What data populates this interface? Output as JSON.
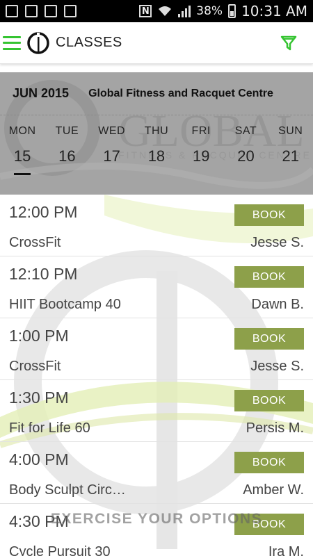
{
  "status_bar": {
    "battery": "38%",
    "time": "10:31 AM"
  },
  "header": {
    "title": "CLASSES"
  },
  "calendar": {
    "month": "JUN 2015",
    "gym_name": "Global Fitness and Racquet Centre",
    "watermark": {
      "brand": "GLOBAL",
      "sub": "FITNESS & RACQUET CENTRE"
    },
    "days": [
      {
        "name": "MON",
        "num": "15"
      },
      {
        "name": "TUE",
        "num": "16"
      },
      {
        "name": "WED",
        "num": "17"
      },
      {
        "name": "THU",
        "num": "18"
      },
      {
        "name": "FRI",
        "num": "19"
      },
      {
        "name": "SAT",
        "num": "20"
      },
      {
        "name": "SUN",
        "num": "21"
      }
    ],
    "selected_day": "15"
  },
  "classes": [
    {
      "time": "12:00 PM",
      "name": "CrossFit",
      "instructor": "Jesse S.",
      "book_label": "BOOK"
    },
    {
      "time": "12:10 PM",
      "name": "HIIT Bootcamp 40",
      "instructor": "Dawn B.",
      "book_label": "BOOK"
    },
    {
      "time": "1:00 PM",
      "name": "CrossFit",
      "instructor": "Jesse S.",
      "book_label": "BOOK"
    },
    {
      "time": "1:30 PM",
      "name": "Fit for Life 60",
      "instructor": "Persis M.",
      "book_label": "BOOK"
    },
    {
      "time": "4:00 PM",
      "name": "Body Sculpt Circ…",
      "instructor": "Amber W.",
      "book_label": "BOOK"
    },
    {
      "time": "4:30 PM",
      "name": "Cycle Pursuit 30",
      "instructor": "Ira M.",
      "book_label": "BOOK"
    }
  ],
  "tagline": "EXERCISE YOUR OPTIONS",
  "colors": {
    "accent": "#35c431",
    "book_button": "#8da04a",
    "calendar_bg": "#a4a4a4"
  }
}
